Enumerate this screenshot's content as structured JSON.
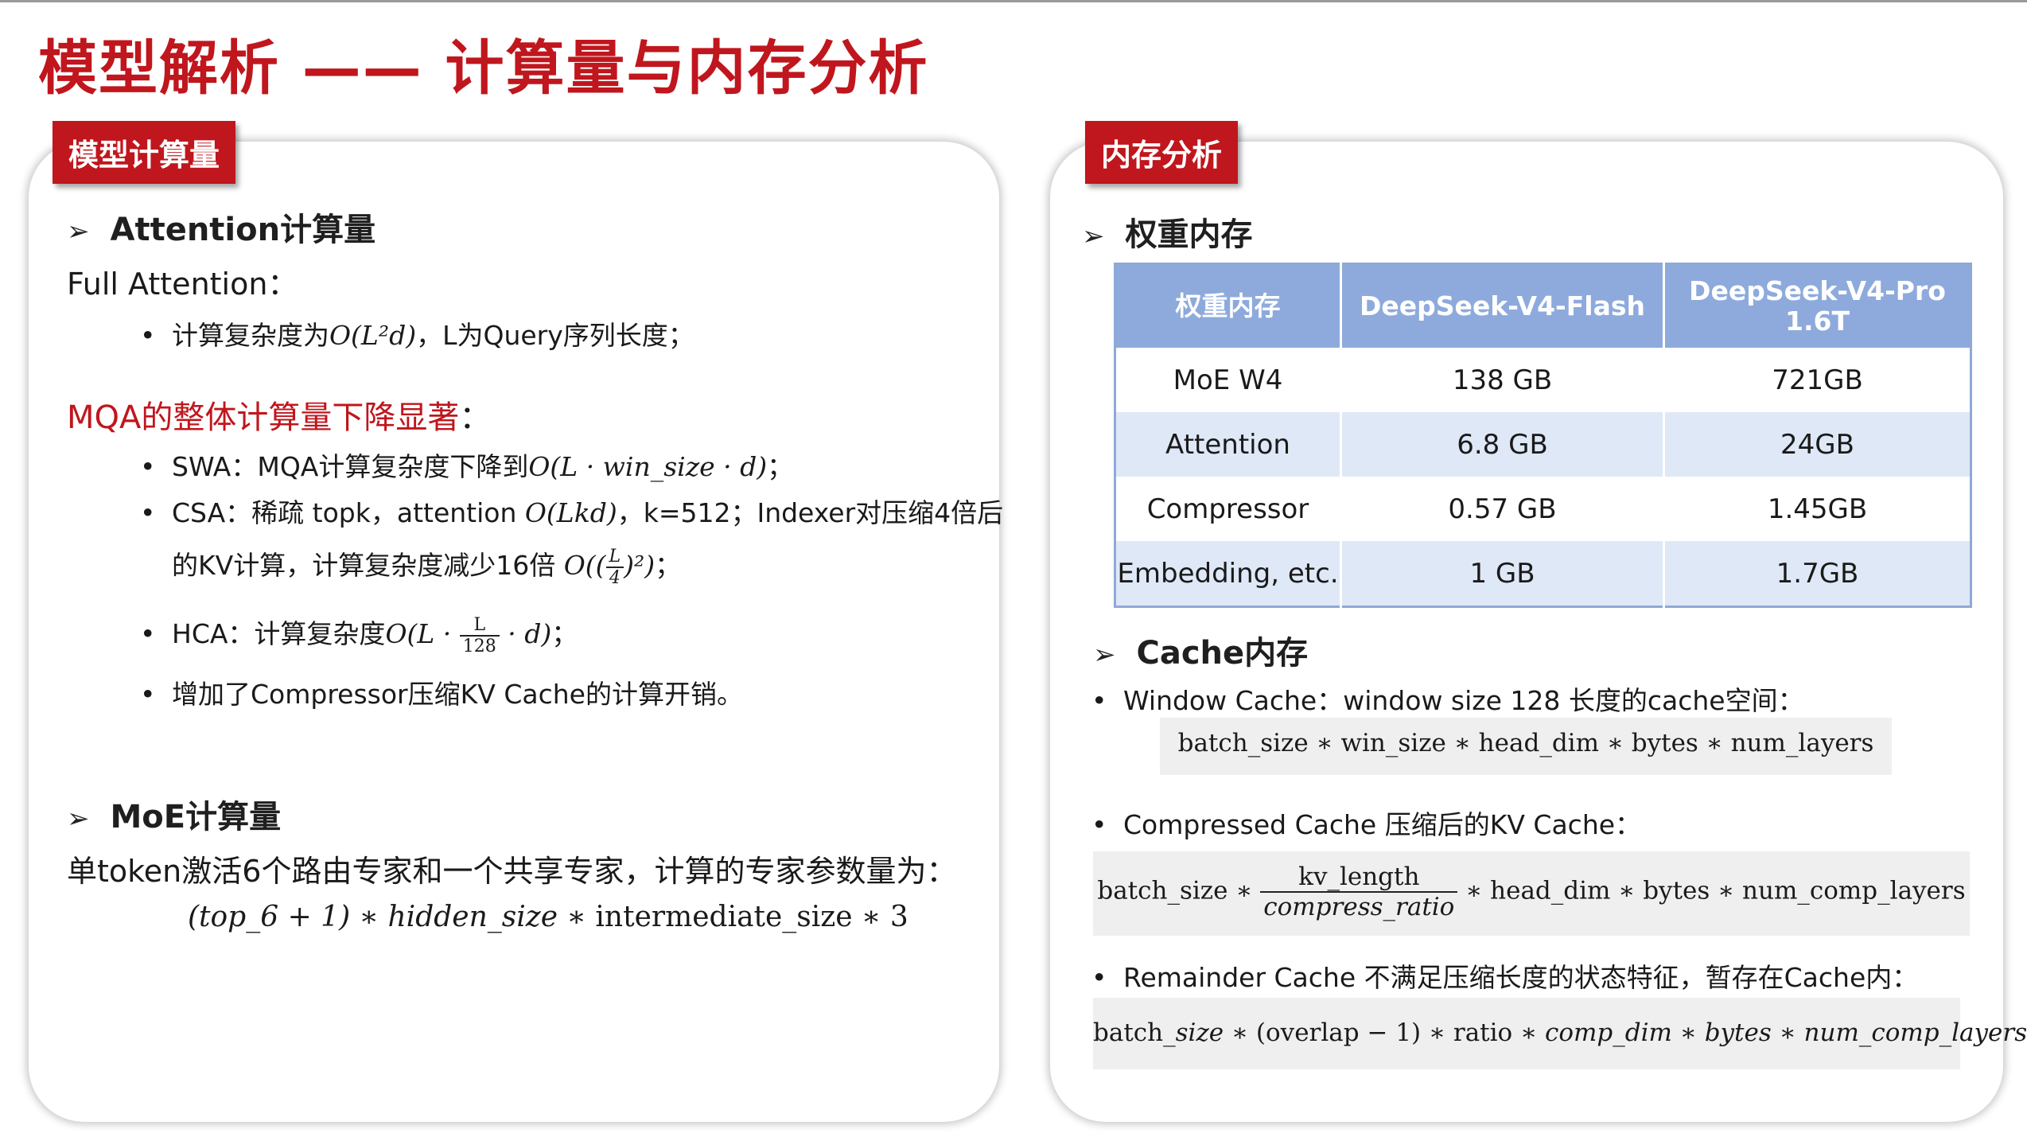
{
  "title": "模型解析 —— 计算量与内存分析",
  "left_panel": {
    "tag": "模型计算量",
    "attention_heading": "Attention计算量",
    "full_attention_label": "Full Attention：",
    "full_attention_bullet_pre": "计算复杂度为",
    "full_attention_bullet_math": "O(L²d)",
    "full_attention_bullet_post": "，L为Query序列长度；",
    "mqa_heading": "MQA的整体计算量下降显著",
    "mqa_colon": "：",
    "swa_pre": "SWA：MQA计算复杂度下降到",
    "swa_math": "O(L · win_size · d)",
    "swa_post": "；",
    "csa_line1_pre": "CSA：稀疏 topk，attention ",
    "csa_line1_math": "O(Lkd)",
    "csa_line1_post": "，k=512；Indexer对压缩4倍后",
    "csa_line2_pre": "的KV计算，计算复杂度减少16倍 ",
    "csa_line2_math_pre": "O((",
    "csa_line2_frac_num": "L",
    "csa_line2_frac_den": "4",
    "csa_line2_math_post": ")²)",
    "csa_line2_post": "；",
    "hca_pre": "HCA：计算复杂度",
    "hca_math_pre": "O(L ·",
    "hca_frac_num": "L",
    "hca_frac_den": "128",
    "hca_math_post": "· d)",
    "hca_post": "；",
    "compressor_bullet": "增加了Compressor压缩KV Cache的计算开销。",
    "moe_heading": "MoE计算量",
    "moe_text": "单token激活6个路由专家和一个共享专家，计算的专家参数量为：",
    "moe_formula_a": "(top_6 + 1) ∗ hidden_size",
    "moe_formula_b": "∗  intermediate_size ∗ 3"
  },
  "right_panel": {
    "tag": "内存分析",
    "weights_heading": "权重内存",
    "table": {
      "headers": [
        "权重内存",
        "DeepSeek-V4-Flash",
        "DeepSeek-V4-Pro",
        "1.6T"
      ],
      "rows": [
        [
          "MoE W4",
          "138 GB",
          "721GB"
        ],
        [
          "Attention",
          "6.8 GB",
          "24GB"
        ],
        [
          "Compressor",
          "0.57 GB",
          "1.45GB"
        ],
        [
          "Embedding, etc.",
          "1 GB",
          "1.7GB"
        ]
      ]
    },
    "cache_heading": "Cache内存",
    "window_cache_text": "Window Cache：window size 128 长度的cache空间：",
    "window_cache_formula": "batch_size ∗ win_size ∗ head_dim ∗ bytes ∗ num_layers",
    "compressed_cache_text": "Compressed Cache 压缩后的KV Cache：",
    "compressed_formula_pre": "batch_size ∗",
    "compressed_formula_num": "kv_length",
    "compressed_formula_den": "compress_ratio",
    "compressed_formula_post": "∗ head_dim ∗ bytes ∗ num_comp_layers",
    "remainder_cache_text": "Remainder Cache 不满足压缩长度的状态特征，暂存在Cache内：",
    "remainder_formula_a": "batch_",
    "remainder_formula_b": "size",
    "remainder_formula_c": " ∗ (overlap − 1) ∗ ratio ∗ ",
    "remainder_formula_d": "comp_dim ∗ bytes ∗ num_comp_layers"
  }
}
